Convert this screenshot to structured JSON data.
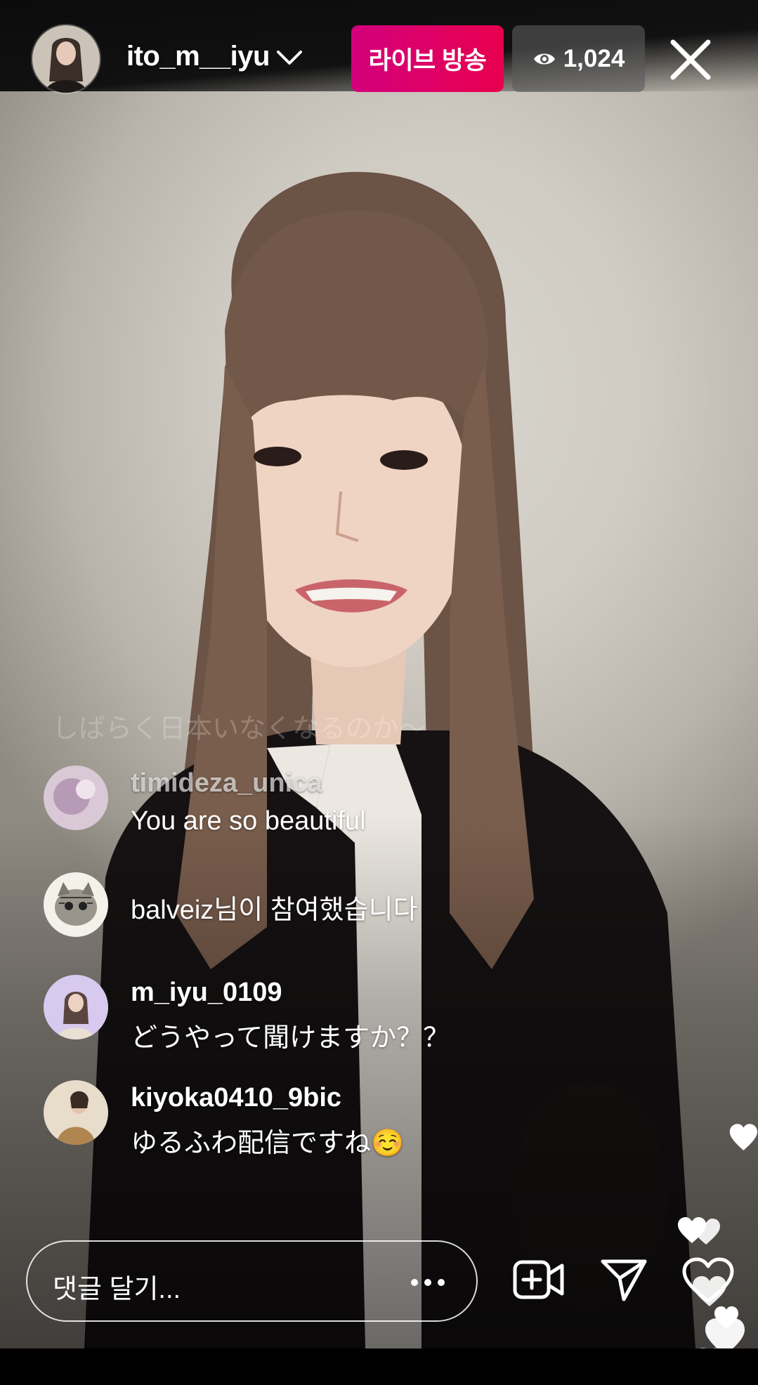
{
  "header": {
    "username": "ito_m__iyu",
    "live_label": "라이브 방송",
    "viewer_count": "1,024"
  },
  "faded_comment": "しばらく日本いなくなるのか〜",
  "comments": [
    {
      "user": "timideza_unica",
      "text": "You are so beautiful"
    },
    {
      "join_text": "balveiz님이 참여했습니다"
    },
    {
      "user": "m_iyu_0109",
      "text": "どうやって聞けますか？？"
    },
    {
      "user": "kiyoka0410_9bic",
      "text": "ゆるふわ配信ですね☺️"
    }
  ],
  "composer": {
    "placeholder": "댓글 달기..."
  },
  "icons": {
    "chevron": "chevron-down-icon",
    "close": "close-icon",
    "eye": "eye-icon",
    "more": "more-horizontal-icon",
    "video_add": "add-video-icon",
    "send": "send-icon",
    "heart": "heart-icon"
  },
  "colors": {
    "live_badge_start": "#d3007c",
    "live_badge_end": "#e8004f",
    "viewer_pill": "#5a5a5a"
  }
}
